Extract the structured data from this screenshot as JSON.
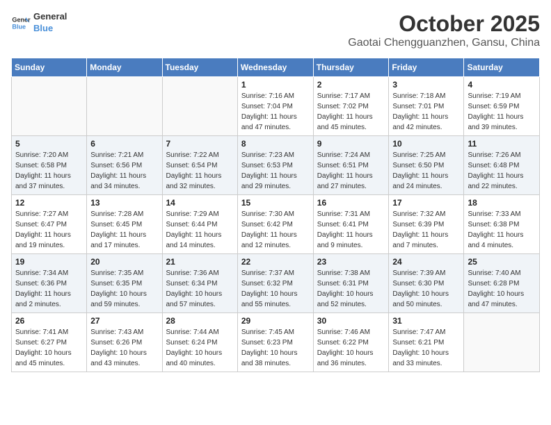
{
  "header": {
    "logo_line1": "General",
    "logo_line2": "Blue",
    "month": "October 2025",
    "location": "Gaotai Chengguanzhen, Gansu, China"
  },
  "weekdays": [
    "Sunday",
    "Monday",
    "Tuesday",
    "Wednesday",
    "Thursday",
    "Friday",
    "Saturday"
  ],
  "weeks": [
    [
      {
        "day": "",
        "info": ""
      },
      {
        "day": "",
        "info": ""
      },
      {
        "day": "",
        "info": ""
      },
      {
        "day": "1",
        "info": "Sunrise: 7:16 AM\nSunset: 7:04 PM\nDaylight: 11 hours and 47 minutes."
      },
      {
        "day": "2",
        "info": "Sunrise: 7:17 AM\nSunset: 7:02 PM\nDaylight: 11 hours and 45 minutes."
      },
      {
        "day": "3",
        "info": "Sunrise: 7:18 AM\nSunset: 7:01 PM\nDaylight: 11 hours and 42 minutes."
      },
      {
        "day": "4",
        "info": "Sunrise: 7:19 AM\nSunset: 6:59 PM\nDaylight: 11 hours and 39 minutes."
      }
    ],
    [
      {
        "day": "5",
        "info": "Sunrise: 7:20 AM\nSunset: 6:58 PM\nDaylight: 11 hours and 37 minutes."
      },
      {
        "day": "6",
        "info": "Sunrise: 7:21 AM\nSunset: 6:56 PM\nDaylight: 11 hours and 34 minutes."
      },
      {
        "day": "7",
        "info": "Sunrise: 7:22 AM\nSunset: 6:54 PM\nDaylight: 11 hours and 32 minutes."
      },
      {
        "day": "8",
        "info": "Sunrise: 7:23 AM\nSunset: 6:53 PM\nDaylight: 11 hours and 29 minutes."
      },
      {
        "day": "9",
        "info": "Sunrise: 7:24 AM\nSunset: 6:51 PM\nDaylight: 11 hours and 27 minutes."
      },
      {
        "day": "10",
        "info": "Sunrise: 7:25 AM\nSunset: 6:50 PM\nDaylight: 11 hours and 24 minutes."
      },
      {
        "day": "11",
        "info": "Sunrise: 7:26 AM\nSunset: 6:48 PM\nDaylight: 11 hours and 22 minutes."
      }
    ],
    [
      {
        "day": "12",
        "info": "Sunrise: 7:27 AM\nSunset: 6:47 PM\nDaylight: 11 hours and 19 minutes."
      },
      {
        "day": "13",
        "info": "Sunrise: 7:28 AM\nSunset: 6:45 PM\nDaylight: 11 hours and 17 minutes."
      },
      {
        "day": "14",
        "info": "Sunrise: 7:29 AM\nSunset: 6:44 PM\nDaylight: 11 hours and 14 minutes."
      },
      {
        "day": "15",
        "info": "Sunrise: 7:30 AM\nSunset: 6:42 PM\nDaylight: 11 hours and 12 minutes."
      },
      {
        "day": "16",
        "info": "Sunrise: 7:31 AM\nSunset: 6:41 PM\nDaylight: 11 hours and 9 minutes."
      },
      {
        "day": "17",
        "info": "Sunrise: 7:32 AM\nSunset: 6:39 PM\nDaylight: 11 hours and 7 minutes."
      },
      {
        "day": "18",
        "info": "Sunrise: 7:33 AM\nSunset: 6:38 PM\nDaylight: 11 hours and 4 minutes."
      }
    ],
    [
      {
        "day": "19",
        "info": "Sunrise: 7:34 AM\nSunset: 6:36 PM\nDaylight: 11 hours and 2 minutes."
      },
      {
        "day": "20",
        "info": "Sunrise: 7:35 AM\nSunset: 6:35 PM\nDaylight: 10 hours and 59 minutes."
      },
      {
        "day": "21",
        "info": "Sunrise: 7:36 AM\nSunset: 6:34 PM\nDaylight: 10 hours and 57 minutes."
      },
      {
        "day": "22",
        "info": "Sunrise: 7:37 AM\nSunset: 6:32 PM\nDaylight: 10 hours and 55 minutes."
      },
      {
        "day": "23",
        "info": "Sunrise: 7:38 AM\nSunset: 6:31 PM\nDaylight: 10 hours and 52 minutes."
      },
      {
        "day": "24",
        "info": "Sunrise: 7:39 AM\nSunset: 6:30 PM\nDaylight: 10 hours and 50 minutes."
      },
      {
        "day": "25",
        "info": "Sunrise: 7:40 AM\nSunset: 6:28 PM\nDaylight: 10 hours and 47 minutes."
      }
    ],
    [
      {
        "day": "26",
        "info": "Sunrise: 7:41 AM\nSunset: 6:27 PM\nDaylight: 10 hours and 45 minutes."
      },
      {
        "day": "27",
        "info": "Sunrise: 7:43 AM\nSunset: 6:26 PM\nDaylight: 10 hours and 43 minutes."
      },
      {
        "day": "28",
        "info": "Sunrise: 7:44 AM\nSunset: 6:24 PM\nDaylight: 10 hours and 40 minutes."
      },
      {
        "day": "29",
        "info": "Sunrise: 7:45 AM\nSunset: 6:23 PM\nDaylight: 10 hours and 38 minutes."
      },
      {
        "day": "30",
        "info": "Sunrise: 7:46 AM\nSunset: 6:22 PM\nDaylight: 10 hours and 36 minutes."
      },
      {
        "day": "31",
        "info": "Sunrise: 7:47 AM\nSunset: 6:21 PM\nDaylight: 10 hours and 33 minutes."
      },
      {
        "day": "",
        "info": ""
      }
    ]
  ]
}
